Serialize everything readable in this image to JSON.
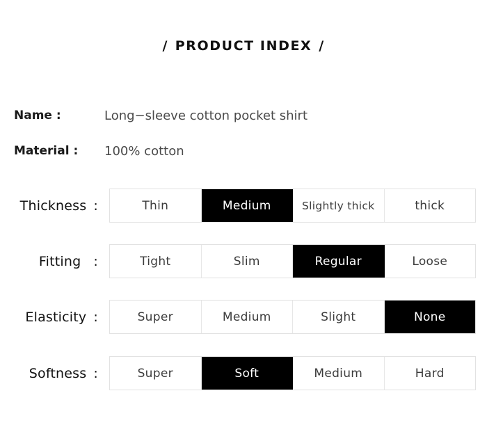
{
  "title": {
    "left_slash": "/",
    "text": "PRODUCT INDEX",
    "right_slash": "/"
  },
  "info": [
    {
      "label": "Name :",
      "value": "Long−sleeve cotton pocket shirt"
    },
    {
      "label": "Material :",
      "value": "100% cotton"
    }
  ],
  "specs": [
    {
      "label": "Thickness",
      "colon": ":",
      "options": [
        {
          "label": "Thin",
          "selected": false
        },
        {
          "label": "Medium",
          "selected": true
        },
        {
          "label": "Slightly thick",
          "selected": false
        },
        {
          "label": "thick",
          "selected": false
        }
      ]
    },
    {
      "label": "Fitting",
      "colon": ":",
      "options": [
        {
          "label": "Tight",
          "selected": false
        },
        {
          "label": "Slim",
          "selected": false
        },
        {
          "label": "Regular",
          "selected": true
        },
        {
          "label": "Loose",
          "selected": false
        }
      ]
    },
    {
      "label": "Elasticity",
      "colon": ":",
      "options": [
        {
          "label": "Super",
          "selected": false
        },
        {
          "label": "Medium",
          "selected": false
        },
        {
          "label": "Slight",
          "selected": false
        },
        {
          "label": "None",
          "selected": true
        }
      ]
    },
    {
      "label": "Softness",
      "colon": ":",
      "options": [
        {
          "label": "Super",
          "selected": false
        },
        {
          "label": "Soft",
          "selected": true
        },
        {
          "label": "Medium",
          "selected": false
        },
        {
          "label": "Hard",
          "selected": false
        }
      ]
    }
  ],
  "colors": {
    "selected_background": "#000000",
    "selected_text": "#ffffff",
    "cell_border": "#e2e2e2",
    "page_background": "#ffffff",
    "label_text": "#111111",
    "value_text": "#4a4a4a"
  }
}
